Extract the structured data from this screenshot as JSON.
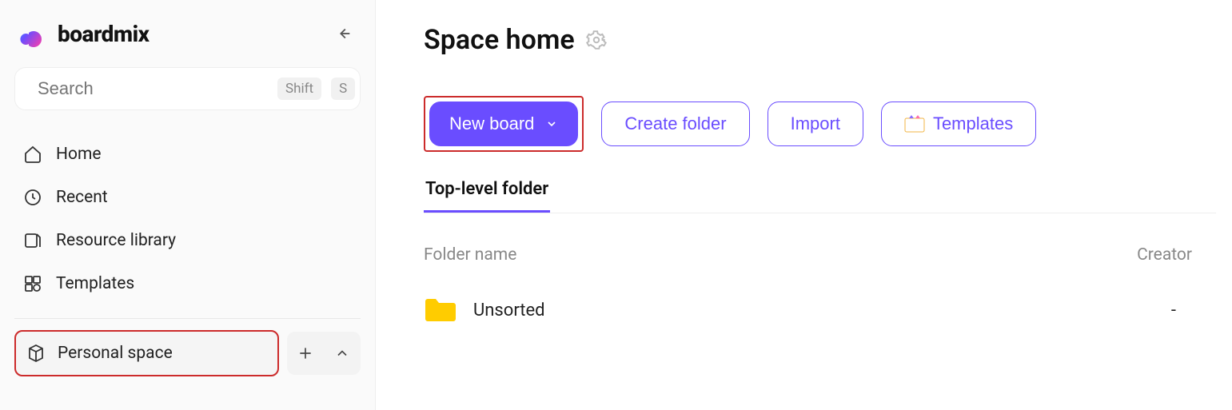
{
  "brand": {
    "name": "boardmix"
  },
  "search": {
    "placeholder": "Search",
    "shortcut1": "Shift",
    "shortcut2": "S"
  },
  "nav": {
    "home": "Home",
    "recent": "Recent",
    "resource": "Resource library",
    "templates": "Templates"
  },
  "space": {
    "personal": "Personal space"
  },
  "page": {
    "title": "Space home"
  },
  "actions": {
    "new_board": "New board",
    "create_folder": "Create folder",
    "import": "Import",
    "templates": "Templates"
  },
  "tabs": {
    "top_level_folder": "Top-level folder"
  },
  "table": {
    "col_folder": "Folder name",
    "col_creator": "Creator",
    "rows": [
      {
        "name": "Unsorted",
        "creator": "-"
      }
    ]
  }
}
